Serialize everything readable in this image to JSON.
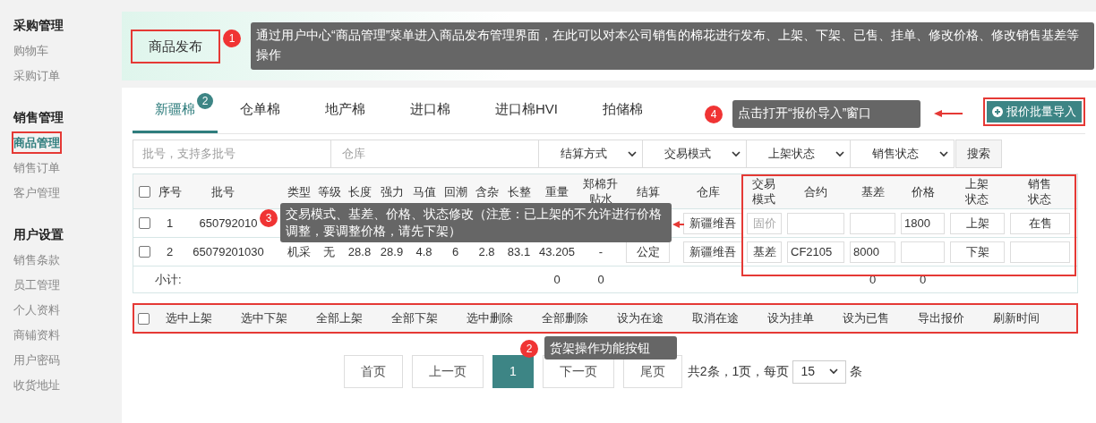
{
  "sidebar": {
    "groups": [
      {
        "title": "采购管理",
        "items": [
          {
            "label": "购物车",
            "selected": false
          },
          {
            "label": "采购订单",
            "selected": false
          }
        ]
      },
      {
        "title": "销售管理",
        "items": [
          {
            "label": "商品管理",
            "selected": true
          },
          {
            "label": "销售订单",
            "selected": false
          },
          {
            "label": "客户管理",
            "selected": false
          }
        ]
      },
      {
        "title": "用户设置",
        "items": [
          {
            "label": "销售条款",
            "selected": false
          },
          {
            "label": "员工管理",
            "selected": false
          },
          {
            "label": "个人资料",
            "selected": false
          },
          {
            "label": "商铺资料",
            "selected": false
          },
          {
            "label": "用户密码",
            "selected": false
          },
          {
            "label": "收货地址",
            "selected": false
          }
        ]
      }
    ]
  },
  "page_title": "商品发布",
  "tabs": [
    {
      "label": "新疆棉",
      "selected": true,
      "badge": "2"
    },
    {
      "label": "仓单棉",
      "selected": false
    },
    {
      "label": "地产棉",
      "selected": false
    },
    {
      "label": "进口棉",
      "selected": false
    },
    {
      "label": "进口棉HVI",
      "selected": false
    },
    {
      "label": "拍储棉",
      "selected": false
    }
  ],
  "import_button": "报价批量导入",
  "filters": {
    "batch_placeholder": "批号，支持多批号",
    "warehouse_placeholder": "仓库",
    "selects": [
      "结算方式",
      "交易模式",
      "上架状态",
      "销售状态"
    ],
    "search_button": "搜索"
  },
  "table": {
    "header_checked": false,
    "columns": [
      {
        "label": "序号",
        "kind": "text"
      },
      {
        "label": "批号",
        "kind": "text"
      },
      {
        "label": "类型",
        "kind": "text"
      },
      {
        "label": "等级",
        "kind": "text"
      },
      {
        "label": "长度",
        "kind": "text"
      },
      {
        "label": "强力",
        "kind": "text"
      },
      {
        "label": "马值",
        "kind": "text"
      },
      {
        "label": "回潮",
        "kind": "text"
      },
      {
        "label": "含杂",
        "kind": "text"
      },
      {
        "label": "长整",
        "kind": "text"
      },
      {
        "label": "重量",
        "kind": "text"
      },
      {
        "label": "郑棉升贴水",
        "kind": "text"
      },
      {
        "label": "结算",
        "kind": "box"
      },
      {
        "label": "仓库",
        "kind": "box"
      },
      {
        "label": "交易模式",
        "kind": "mode"
      },
      {
        "label": "合约",
        "kind": "input"
      },
      {
        "label": "基差",
        "kind": "input"
      },
      {
        "label": "价格",
        "kind": "input"
      },
      {
        "label": "上架状态",
        "kind": "box"
      },
      {
        "label": "销售状态",
        "kind": "box"
      }
    ],
    "rows": [
      {
        "checked": false,
        "mode_disabled": true,
        "cells": [
          "1",
          "650792010",
          "",
          "",
          "",
          "",
          "",
          "",
          "",
          "",
          "",
          "",
          "",
          "新疆维吾",
          "固价",
          "",
          "",
          "1800",
          "上架",
          "在售"
        ]
      },
      {
        "checked": false,
        "mode_disabled": false,
        "cells": [
          "2",
          "65079201030",
          "机采",
          "无",
          "28.8",
          "28.9",
          "4.8",
          "6",
          "2.8",
          "83.1",
          "43.205",
          "-",
          "公定",
          "新疆维吾",
          "基差",
          "CF2105",
          "8000",
          "",
          "下架",
          ""
        ]
      }
    ],
    "subtotal": {
      "label": "小计:",
      "cells": [
        "",
        "",
        "",
        "",
        "",
        "",
        "",
        "",
        "",
        "",
        "0",
        "0",
        "",
        "",
        "",
        "",
        "0",
        "0",
        "",
        ""
      ]
    }
  },
  "actions": {
    "checked": false,
    "buttons": [
      "选中上架",
      "选中下架",
      "全部上架",
      "全部下架",
      "选中删除",
      "全部删除",
      "设为在途",
      "取消在途",
      "设为挂单",
      "设为已售",
      "导出报价",
      "刷新时间"
    ]
  },
  "pagination": {
    "pages": [
      {
        "label": "首页",
        "selected": false
      },
      {
        "label": "上一页",
        "selected": false
      },
      {
        "label": "1",
        "selected": true
      },
      {
        "label": "下一页",
        "selected": false
      },
      {
        "label": "尾页",
        "selected": false
      }
    ],
    "summary": "共2条，1页，每页",
    "page_size": "15",
    "unit": "条"
  },
  "annotations": [
    {
      "number": "1",
      "text": "通过用户中心“商品管理”菜单进入商品发布管理界面，在此可以对本公司销售的棉花进行发布、上架、下架、已售、挂单、修改价格、修改销售基差等操作"
    },
    {
      "number": "4",
      "text": "点击打开“报价导入”窗口"
    },
    {
      "number": "3",
      "text": "交易模式、基差、价格、状态修改（注意：已上架的不允许进行价格调整，要调整价格，请先下架）"
    },
    {
      "number": "2",
      "text": "货架操作功能按钮"
    }
  ]
}
